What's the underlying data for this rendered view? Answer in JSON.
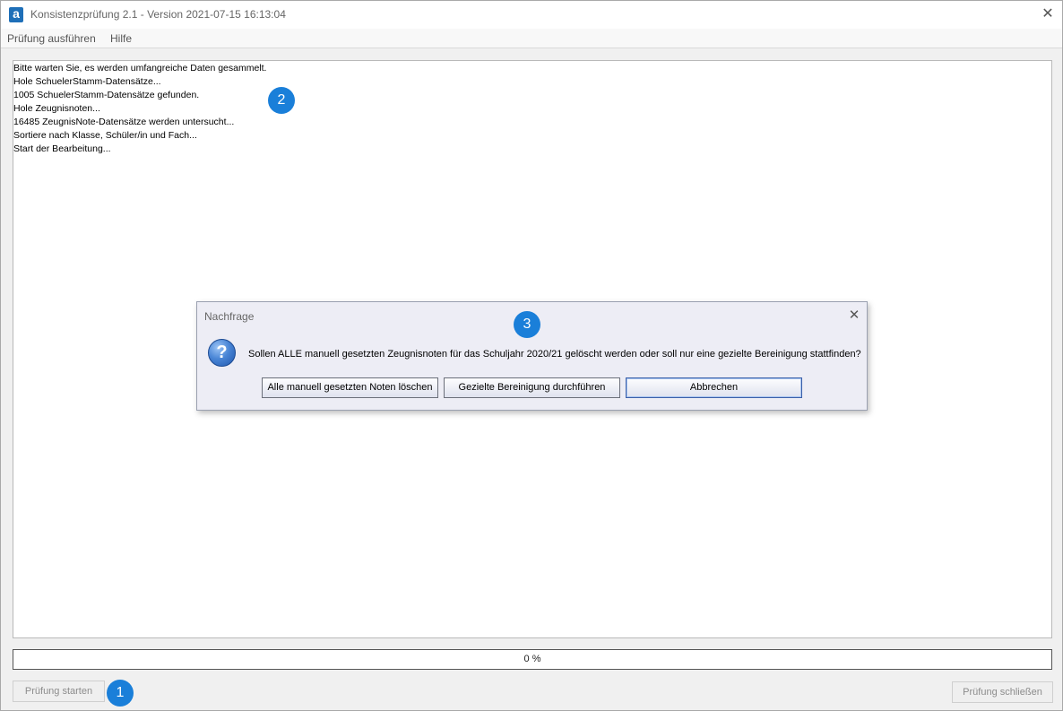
{
  "window": {
    "title": "Konsistenzprüfung 2.1 - Version 2021-07-15 16:13:04",
    "app_icon_glyph": "a",
    "close_glyph": "✕"
  },
  "menu": {
    "items": [
      "Prüfung ausführen",
      "Hilfe"
    ]
  },
  "log": {
    "lines": [
      "Bitte warten Sie, es werden umfangreiche Daten gesammelt.",
      "Hole SchuelerStamm-Datensätze...",
      "1005 SchuelerStamm-Datensätze gefunden.",
      "Hole Zeugnisnoten...",
      "16485 ZeugnisNote-Datensätze werden untersucht...",
      "Sortiere nach Klasse, Schüler/in und Fach...",
      "Start der Bearbeitung..."
    ]
  },
  "progress": {
    "value": 0,
    "label": "0 %"
  },
  "buttons": {
    "start": "Prüfung starten",
    "close": "Prüfung schließen"
  },
  "badges": [
    "1",
    "2",
    "3"
  ],
  "dialog": {
    "title": "Nachfrage",
    "close_glyph": "✕",
    "icon": "question-icon",
    "icon_glyph": "?",
    "message": "Sollen ALLE manuell gesetzten Zeugnisnoten für das Schuljahr 2020/21 gelöscht werden oder soll nur eine gezielte Bereinigung stattfinden?",
    "buttons": [
      "Alle manuell gesetzten Noten löschen",
      "Gezielte Bereinigung durchführen",
      "Abbrechen"
    ]
  },
  "colors": {
    "badge": "#1a7fd9",
    "app_icon": "#1e6fb8"
  }
}
